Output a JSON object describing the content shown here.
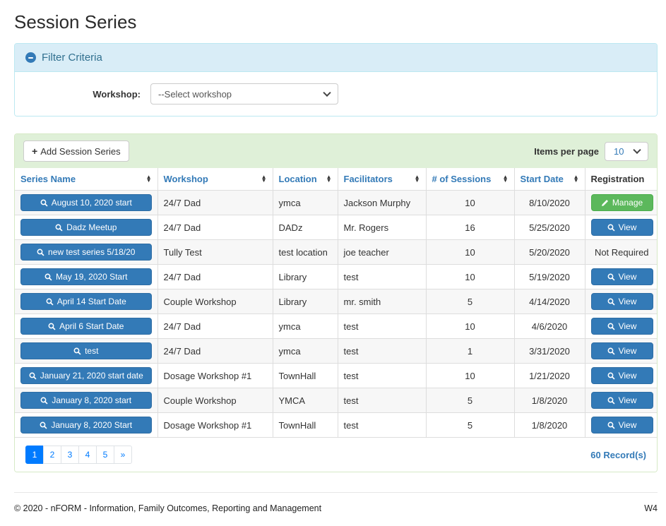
{
  "page": {
    "title": "Session Series"
  },
  "filter": {
    "title": "Filter Criteria",
    "collapse_icon": "minus-circle",
    "workshop_label": "Workshop:",
    "workshop_selected": "--Select workshop"
  },
  "toolbar": {
    "add_button_label": "Add Session Series",
    "add_icon": "plus",
    "items_per_page_label": "Items per page",
    "items_per_page_value": "10"
  },
  "colors": {
    "accent_blue": "#337ab7",
    "panel_info_bg": "#d9edf7",
    "panel_success_bg": "#dff0d8",
    "button_success": "#5cb85c",
    "pagination_active": "#007bff"
  },
  "table": {
    "columns": [
      {
        "label": "Series Name",
        "sortable": true
      },
      {
        "label": "Workshop",
        "sortable": true
      },
      {
        "label": "Location",
        "sortable": true
      },
      {
        "label": "Facilitators",
        "sortable": true
      },
      {
        "label": "# of Sessions",
        "sortable": true
      },
      {
        "label": "Start Date",
        "sortable": true
      },
      {
        "label": "Registration",
        "sortable": false
      }
    ],
    "rows": [
      {
        "series_name": "August 10, 2020 start",
        "workshop": "24/7 Dad",
        "location": "ymca",
        "facilitators": "Jackson Murphy",
        "sessions": "10",
        "start_date": "8/10/2020",
        "registration": "Manage"
      },
      {
        "series_name": "Dadz Meetup",
        "workshop": "24/7 Dad",
        "location": "DADz",
        "facilitators": "Mr. Rogers",
        "sessions": "16",
        "start_date": "5/25/2020",
        "registration": "View"
      },
      {
        "series_name": "new test series 5/18/20",
        "workshop": "Tully Test",
        "location": "test location",
        "facilitators": "joe teacher",
        "sessions": "10",
        "start_date": "5/20/2020",
        "registration": "Not Required"
      },
      {
        "series_name": "May 19, 2020 Start",
        "workshop": "24/7 Dad",
        "location": "Library",
        "facilitators": "test",
        "sessions": "10",
        "start_date": "5/19/2020",
        "registration": "View"
      },
      {
        "series_name": "April 14 Start Date",
        "workshop": "Couple Workshop",
        "location": "Library",
        "facilitators": "mr. smith",
        "sessions": "5",
        "start_date": "4/14/2020",
        "registration": "View"
      },
      {
        "series_name": "April 6 Start Date",
        "workshop": "24/7 Dad",
        "location": "ymca",
        "facilitators": "test",
        "sessions": "10",
        "start_date": "4/6/2020",
        "registration": "View"
      },
      {
        "series_name": "test",
        "workshop": "24/7 Dad",
        "location": "ymca",
        "facilitators": "test",
        "sessions": "1",
        "start_date": "3/31/2020",
        "registration": "View"
      },
      {
        "series_name": "January 21, 2020 start date",
        "workshop": "Dosage Workshop #1",
        "location": "TownHall",
        "facilitators": "test",
        "sessions": "10",
        "start_date": "1/21/2020",
        "registration": "View"
      },
      {
        "series_name": "January 8, 2020 start",
        "workshop": "Couple Workshop",
        "location": "YMCA",
        "facilitators": "test",
        "sessions": "5",
        "start_date": "1/8/2020",
        "registration": "View"
      },
      {
        "series_name": "January 8, 2020 Start",
        "workshop": "Dosage Workshop #1",
        "location": "TownHall",
        "facilitators": "test",
        "sessions": "5",
        "start_date": "1/8/2020",
        "registration": "View"
      }
    ]
  },
  "pagination": {
    "pages": [
      "1",
      "2",
      "3",
      "4",
      "5",
      "»"
    ],
    "active": "1",
    "record_count": "60 Record(s)"
  },
  "footer": {
    "copyright": "© 2020 - nFORM - Information, Family Outcomes, Reporting and Management",
    "version": "W4"
  }
}
